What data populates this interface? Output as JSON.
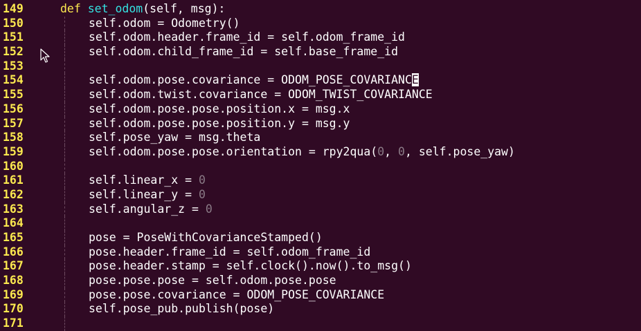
{
  "editor": {
    "lines": [
      {
        "n": "149",
        "indent": 1,
        "parts": [
          {
            "t": "def",
            "c": "kw"
          },
          {
            "t": " "
          },
          {
            "t": "set_odom",
            "c": "fn"
          },
          {
            "t": "(self, msg):"
          }
        ]
      },
      {
        "n": "150",
        "indent": 2,
        "parts": [
          {
            "t": "self.odom = Odometry()"
          }
        ]
      },
      {
        "n": "151",
        "indent": 2,
        "parts": [
          {
            "t": "self.odom.header.frame_id = self.odom_frame_id"
          }
        ]
      },
      {
        "n": "152",
        "indent": 2,
        "parts": [
          {
            "t": "self.odom.child_frame_id = self.base_frame_id"
          }
        ]
      },
      {
        "n": "153",
        "indent": 0,
        "parts": []
      },
      {
        "n": "154",
        "indent": 2,
        "parts": [
          {
            "t": "self.odom.pose.covariance = ODOM_POSE_COVARIANC"
          },
          {
            "t": "E",
            "c": "cursor"
          }
        ]
      },
      {
        "n": "155",
        "indent": 2,
        "parts": [
          {
            "t": "self.odom.twist.covariance = ODOM_TWIST_COVARIANCE"
          }
        ]
      },
      {
        "n": "156",
        "indent": 2,
        "parts": [
          {
            "t": "self.odom.pose.pose.position.x = msg.x"
          }
        ]
      },
      {
        "n": "157",
        "indent": 2,
        "parts": [
          {
            "t": "self.odom.pose.pose.position.y = msg.y"
          }
        ]
      },
      {
        "n": "158",
        "indent": 2,
        "parts": [
          {
            "t": "self.pose_yaw = msg.theta"
          }
        ]
      },
      {
        "n": "159",
        "indent": 2,
        "parts": [
          {
            "t": "self.odom.pose.pose.orientation = rpy2qua("
          },
          {
            "t": "0",
            "c": "num"
          },
          {
            "t": ", "
          },
          {
            "t": "0",
            "c": "num"
          },
          {
            "t": ", self.pose_yaw)"
          }
        ]
      },
      {
        "n": "160",
        "indent": 0,
        "parts": []
      },
      {
        "n": "161",
        "indent": 2,
        "parts": [
          {
            "t": "self.linear_x = "
          },
          {
            "t": "0",
            "c": "num"
          }
        ]
      },
      {
        "n": "162",
        "indent": 2,
        "parts": [
          {
            "t": "self.linear_y = "
          },
          {
            "t": "0",
            "c": "num"
          }
        ]
      },
      {
        "n": "163",
        "indent": 2,
        "parts": [
          {
            "t": "self.angular_z = "
          },
          {
            "t": "0",
            "c": "num"
          }
        ]
      },
      {
        "n": "164",
        "indent": 0,
        "parts": []
      },
      {
        "n": "165",
        "indent": 2,
        "parts": [
          {
            "t": "pose = PoseWithCovarianceStamped()"
          }
        ]
      },
      {
        "n": "166",
        "indent": 2,
        "parts": [
          {
            "t": "pose.header.frame_id = self.odom_frame_id"
          }
        ]
      },
      {
        "n": "167",
        "indent": 2,
        "parts": [
          {
            "t": "pose.header.stamp = self.clock().now().to_msg()"
          }
        ]
      },
      {
        "n": "168",
        "indent": 2,
        "parts": [
          {
            "t": "pose.pose.pose = self.odom.pose.pose"
          }
        ]
      },
      {
        "n": "169",
        "indent": 2,
        "parts": [
          {
            "t": "pose.pose.covariance = ODOM_POSE_COVARIANCE"
          }
        ]
      },
      {
        "n": "170",
        "indent": 2,
        "parts": [
          {
            "t": "self.pose_pub.publish(pose)"
          }
        ]
      },
      {
        "n": "171",
        "indent": 0,
        "parts": []
      }
    ]
  },
  "cursor_icon": "mouse-pointer-icon"
}
